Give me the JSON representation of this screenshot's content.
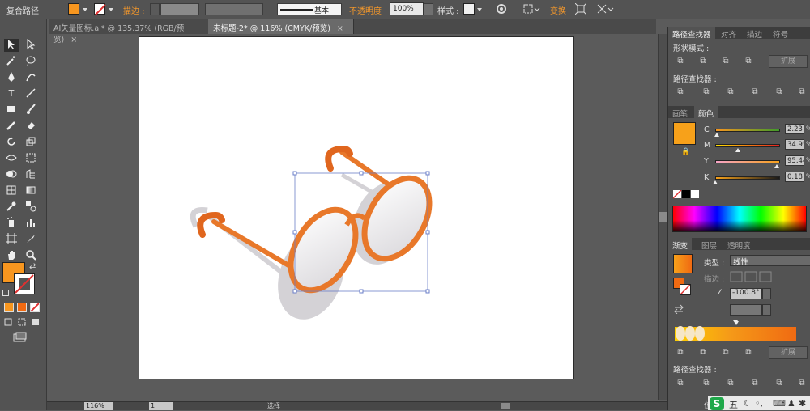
{
  "control_bar": {
    "selection_type": "复合路径",
    "stroke_label": "描边 :",
    "stroke_profile": "基本",
    "opacity_label": "不透明度",
    "opacity_value": "100%",
    "style_label": "样式 :",
    "transform_label": "变换"
  },
  "tabs": [
    {
      "label": "AI矢量图标.ai* @ 135.37% (RGB/预览)",
      "close": "×"
    },
    {
      "label": "未标题-2* @ 116% (CMYK/预览)",
      "close": "×"
    }
  ],
  "tools": {
    "text_tool": "T"
  },
  "status_bar": {
    "zoom": "116%",
    "page": "1",
    "mode": "选择"
  },
  "panels": {
    "pathfinder": {
      "tabs": [
        "路径查找器",
        "对齐",
        "描边",
        "符号"
      ],
      "shape_modes_label": "形状模式 :",
      "expand_label": "扩展",
      "pathfinders_label": "路径查找器 :"
    },
    "color": {
      "tabs": [
        "画笔",
        "颜色"
      ],
      "channels": [
        {
          "label": "C",
          "value": "2.23",
          "unit": "%",
          "level": 0.0223
        },
        {
          "label": "M",
          "value": "34.95",
          "unit": "%",
          "level": 0.3495
        },
        {
          "label": "Y",
          "value": "95.44",
          "unit": "%",
          "level": 0.9544
        },
        {
          "label": "K",
          "value": "0.18",
          "unit": "%",
          "level": 0.0018
        }
      ],
      "fill_color": "#f7a11a"
    },
    "gradient": {
      "tabs": [
        "渐变",
        "图层",
        "透明度"
      ],
      "type_label": "类型 :",
      "type_value": "线性",
      "stroke_label": "描边 :",
      "angle_value": "-100.8°",
      "expand_label": "扩展",
      "pathfinders_label": "路径查找器 :",
      "colors": [
        "#ffd000",
        "#f59a18",
        "#f06a12"
      ]
    }
  },
  "taskbar": {
    "ime": "五",
    "bottom_label": "位"
  },
  "colors": {
    "accent_orange": "#f0962c",
    "glasses_orange": "#e8782a",
    "fill": "#f7a11a"
  }
}
